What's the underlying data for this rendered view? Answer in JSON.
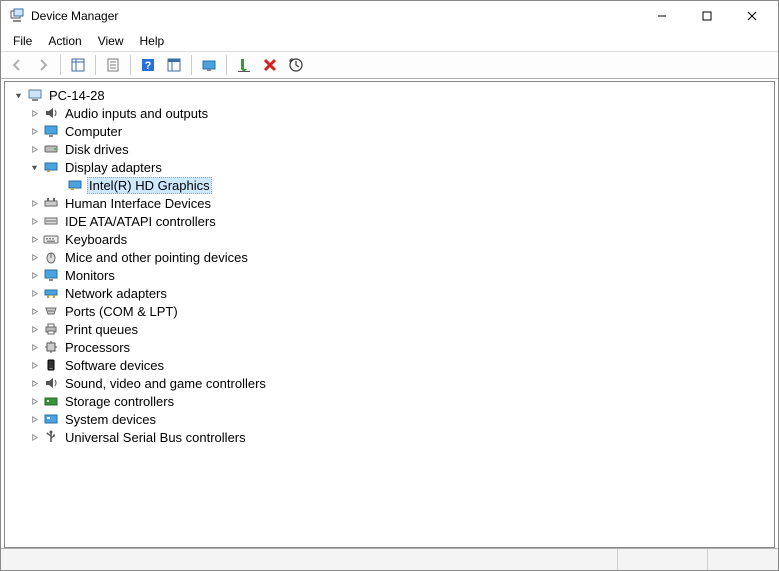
{
  "window": {
    "title": "Device Manager"
  },
  "menu": {
    "file": "File",
    "action": "Action",
    "view": "View",
    "help": "Help"
  },
  "tree": {
    "root": "PC-14-28",
    "categories": [
      {
        "label": "Audio inputs and outputs"
      },
      {
        "label": "Computer"
      },
      {
        "label": "Disk drives"
      },
      {
        "label": "Display adapters",
        "expanded": true,
        "children": [
          {
            "label": "Intel(R) HD Graphics",
            "selected": true
          }
        ]
      },
      {
        "label": "Human Interface Devices"
      },
      {
        "label": "IDE ATA/ATAPI controllers"
      },
      {
        "label": "Keyboards"
      },
      {
        "label": "Mice and other pointing devices"
      },
      {
        "label": "Monitors"
      },
      {
        "label": "Network adapters"
      },
      {
        "label": "Ports (COM & LPT)"
      },
      {
        "label": "Print queues"
      },
      {
        "label": "Processors"
      },
      {
        "label": "Software devices"
      },
      {
        "label": "Sound, video and game controllers"
      },
      {
        "label": "Storage controllers"
      },
      {
        "label": "System devices"
      },
      {
        "label": "Universal Serial Bus controllers"
      }
    ]
  }
}
